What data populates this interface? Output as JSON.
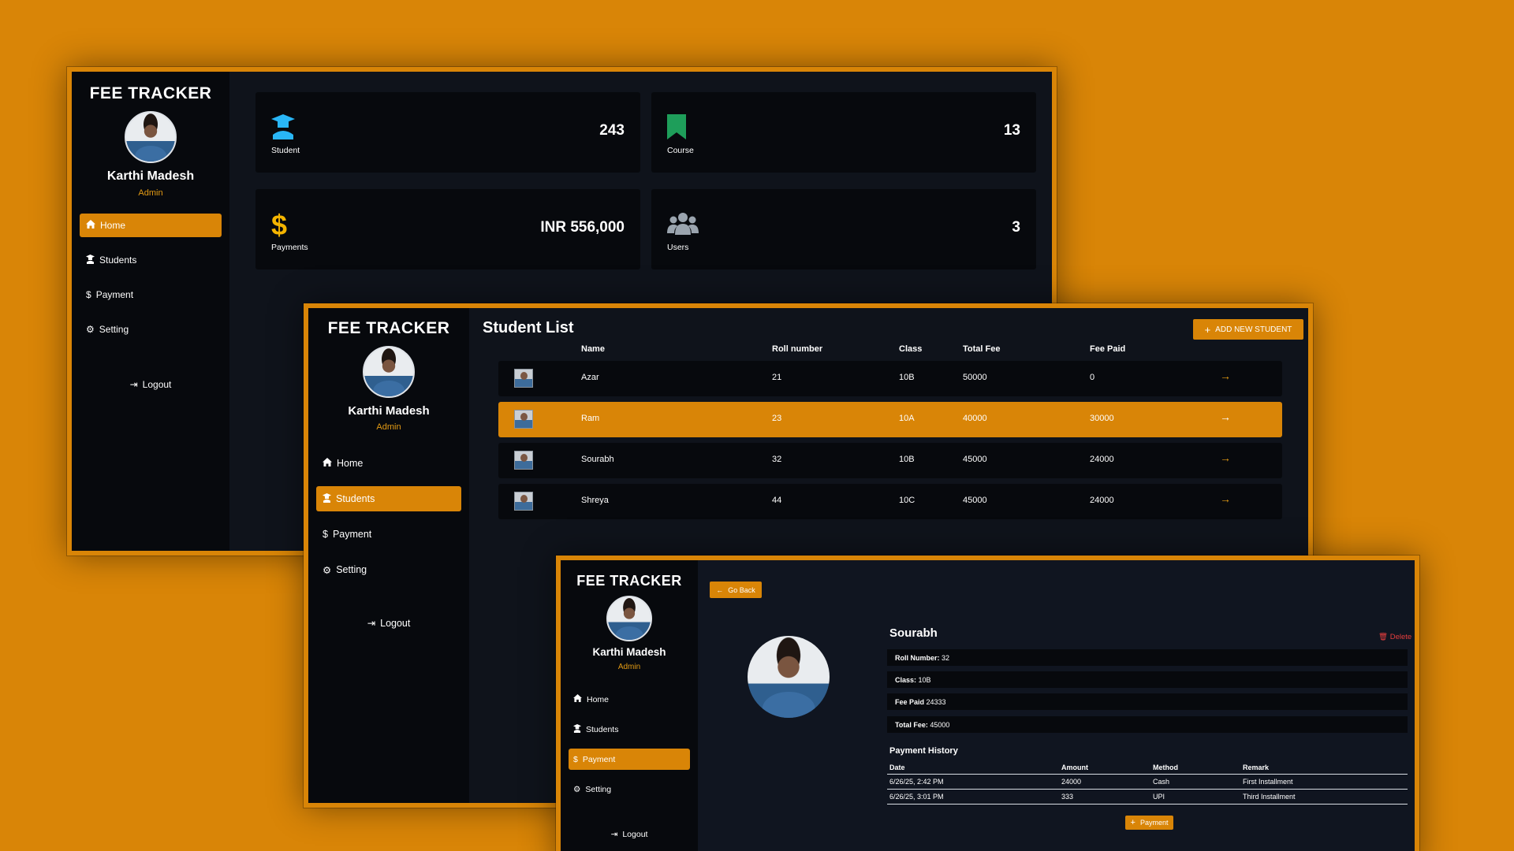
{
  "brand": "FEE TRACKER",
  "user": {
    "name": "Karthi Madesh",
    "role": "Admin"
  },
  "nav": {
    "home": "Home",
    "students": "Students",
    "payment": "Payment",
    "setting": "Setting",
    "logout": "Logout"
  },
  "dashboard": {
    "cards": [
      {
        "label": "Student",
        "value": "243",
        "icon": "graduate-icon",
        "color": "#29b6f6"
      },
      {
        "label": "Course",
        "value": "13",
        "icon": "bookmark-icon",
        "color": "#1e9e5a"
      },
      {
        "label": "Payments",
        "value": "INR 556,000",
        "icon": "dollar-icon",
        "color": "#f4b400"
      },
      {
        "label": "Users",
        "value": "3",
        "icon": "users-icon",
        "color": "#9aa4ae"
      }
    ]
  },
  "student_list": {
    "title": "Student List",
    "add_button": "ADD NEW STUDENT",
    "columns": [
      "Name",
      "Roll number",
      "Class",
      "Total Fee",
      "Fee Paid"
    ],
    "rows": [
      {
        "name": "Azar",
        "roll": "21",
        "class": "10B",
        "total_fee": "50000",
        "fee_paid": "0"
      },
      {
        "name": "Ram",
        "roll": "23",
        "class": "10A",
        "total_fee": "40000",
        "fee_paid": "30000"
      },
      {
        "name": "Sourabh",
        "roll": "32",
        "class": "10B",
        "total_fee": "45000",
        "fee_paid": "24000"
      },
      {
        "name": "Shreya",
        "roll": "44",
        "class": "10C",
        "total_fee": "45000",
        "fee_paid": "24000"
      }
    ]
  },
  "student_detail": {
    "go_back": "Go Back",
    "name": "Sourabh",
    "delete": "Delete",
    "fields": [
      {
        "label": "Roll Number:",
        "value": "32"
      },
      {
        "label": "Class:",
        "value": "10B"
      },
      {
        "label": "Fee Paid",
        "value": "24333"
      },
      {
        "label": "Total Fee:",
        "value": "45000"
      }
    ],
    "history_title": "Payment History",
    "history_columns": [
      "Date",
      "Amount",
      "Method",
      "Remark"
    ],
    "history": [
      {
        "date": "6/26/25, 2:42 PM",
        "amount": "24000",
        "method": "Cash",
        "remark": "First Installment"
      },
      {
        "date": "6/26/25, 3:01 PM",
        "amount": "333",
        "method": "UPI",
        "remark": "Third Installment"
      }
    ],
    "payment_button": "Payment"
  },
  "colors": {
    "accent": "#d98507",
    "panel": "#07090d",
    "danger": "#e53e3e"
  }
}
